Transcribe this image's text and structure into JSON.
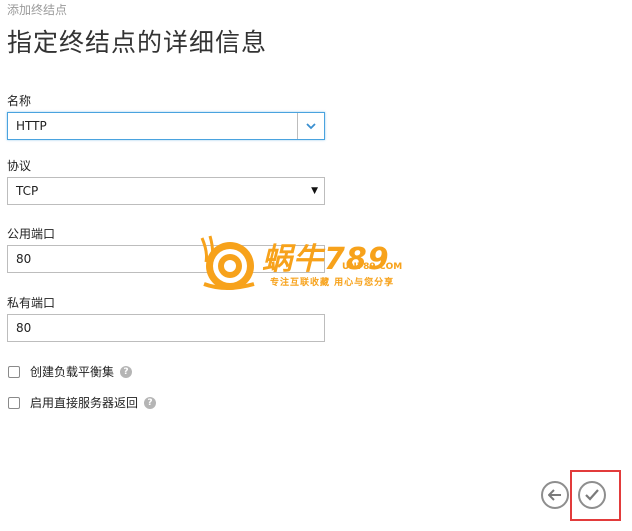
{
  "header": {
    "subtitle": "添加终结点",
    "title": "指定终结点的详细信息"
  },
  "form": {
    "name": {
      "label": "名称",
      "value": "HTTP"
    },
    "protocol": {
      "label": "协议",
      "value": "TCP"
    },
    "public_port": {
      "label": "公用端口",
      "value": "80"
    },
    "private_port": {
      "label": "私有端口",
      "value": "80"
    },
    "load_balance": {
      "label": "创建负载平衡集",
      "help": "?"
    },
    "direct_return": {
      "label": "启用直接服务器返回",
      "help": "?"
    }
  },
  "watermark": {
    "brand": "蜗牛789",
    "domain": "UN789.COM",
    "slogan": "专注互联收藏   用心与您分享"
  },
  "colors": {
    "accent": "#4aa3df",
    "highlight_box": "#e23b3b",
    "watermark": "#f7a21b"
  },
  "icons": {
    "back": "arrow-left-icon",
    "confirm": "checkmark-icon",
    "dropdown": "chevron-down-icon"
  }
}
